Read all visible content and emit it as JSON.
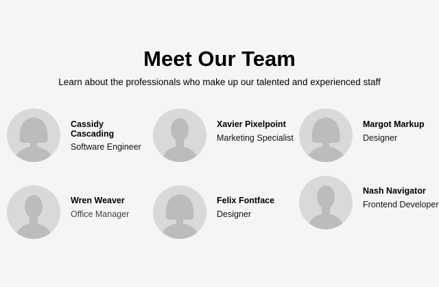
{
  "header": {
    "title": "Meet Our Team",
    "subtitle": "Learn about the professionals who make up our talented and experienced staff"
  },
  "team": [
    {
      "name": "Cassidy Cascading",
      "role": "Software Engineer",
      "avatar": "female-silhouette-icon"
    },
    {
      "name": "Xavier Pixelpoint",
      "role": "Marketing Specialist",
      "avatar": "male-silhouette-icon"
    },
    {
      "name": "Margot Markup",
      "role": "Designer",
      "avatar": "female-silhouette-icon"
    },
    {
      "name": "Wren Weaver",
      "role": "Office Manager",
      "avatar": "male-silhouette-icon"
    },
    {
      "name": "Felix Fontface",
      "role": "Designer",
      "avatar": "female-silhouette-icon"
    },
    {
      "name": "Nash Navigator",
      "role": "Frontend Developer",
      "avatar": "male-silhouette-icon"
    }
  ],
  "colors": {
    "background": "#f5f5f5",
    "avatar_circle": "#d9d9d9",
    "silhouette": "#bcbcbc"
  }
}
